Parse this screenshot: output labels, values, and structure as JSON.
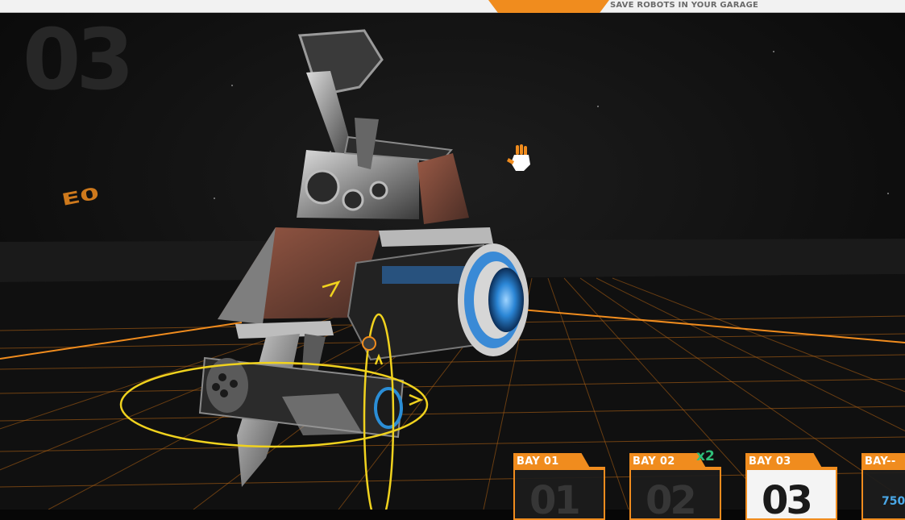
{
  "header": {
    "hint_text": "SAVE ROBOTS IN YOUR GARAGE"
  },
  "garage": {
    "current_bay_number": "03"
  },
  "floor_text": "E0",
  "bays": [
    {
      "label": "BAY 01",
      "number": "01",
      "selected": false
    },
    {
      "label": "BAY 02",
      "number": "02",
      "selected": false
    },
    {
      "label": "BAY 03",
      "number": "03",
      "selected": true
    },
    {
      "label": "BAY--",
      "number": "",
      "selected": false
    }
  ],
  "bay02_badge": "x2",
  "bay04_price": "750",
  "colors": {
    "accent_orange": "#f08c1e",
    "badge_green": "#2fc07a",
    "price_blue": "#4aa8e8",
    "gizmo_yellow": "#f0d21e"
  },
  "icons": {
    "cursor": "hand-cursor-icon"
  }
}
